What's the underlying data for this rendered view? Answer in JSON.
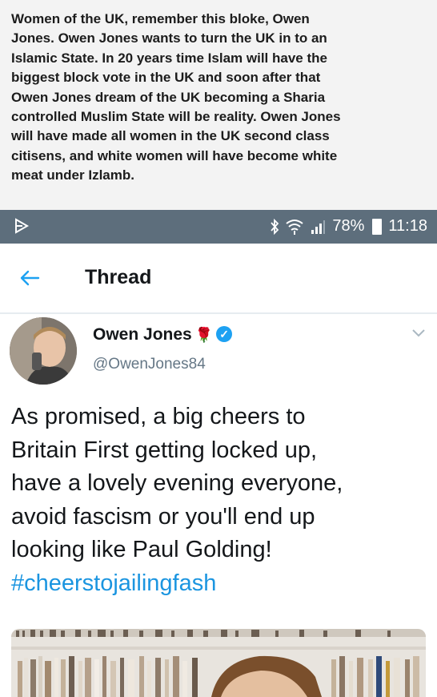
{
  "caption": {
    "lines": [
      "Women of the UK, remember this bloke, Owen",
      "Jones. Owen Jones wants to turn the UK in to an",
      "Islamic State. In 20 years time Islam will have the",
      "biggest block vote in the UK and soon after that",
      "Owen Jones dream of the UK becoming a Sharia",
      "controlled Muslim State will be reality. Owen Jones",
      "will have made all women in the UK second class",
      "citisens, and white women will have become white",
      "meat under Izlamb."
    ]
  },
  "status_bar": {
    "battery": "78%",
    "time": "11:18",
    "icons": [
      "cast-icon",
      "bluetooth-icon",
      "wifi-icon",
      "signal-icon",
      "battery-icon"
    ],
    "background_color": "#5d6e7c"
  },
  "header": {
    "title": "Thread",
    "back_icon": "back-arrow-icon"
  },
  "tweet": {
    "author_name": "Owen Jones",
    "author_emoji": "🌹",
    "handle": "@OwenJones84",
    "text_lines": [
      "As promised, a big cheers to",
      "Britain First getting locked up,",
      "have a lovely evening everyone,",
      "avoid fascism or you'll end up",
      "looking like Paul Golding!"
    ],
    "hashtag": "#cheerstojailingfash",
    "accent_color": "#1b95e0",
    "verified_color": "#1da1f2"
  }
}
